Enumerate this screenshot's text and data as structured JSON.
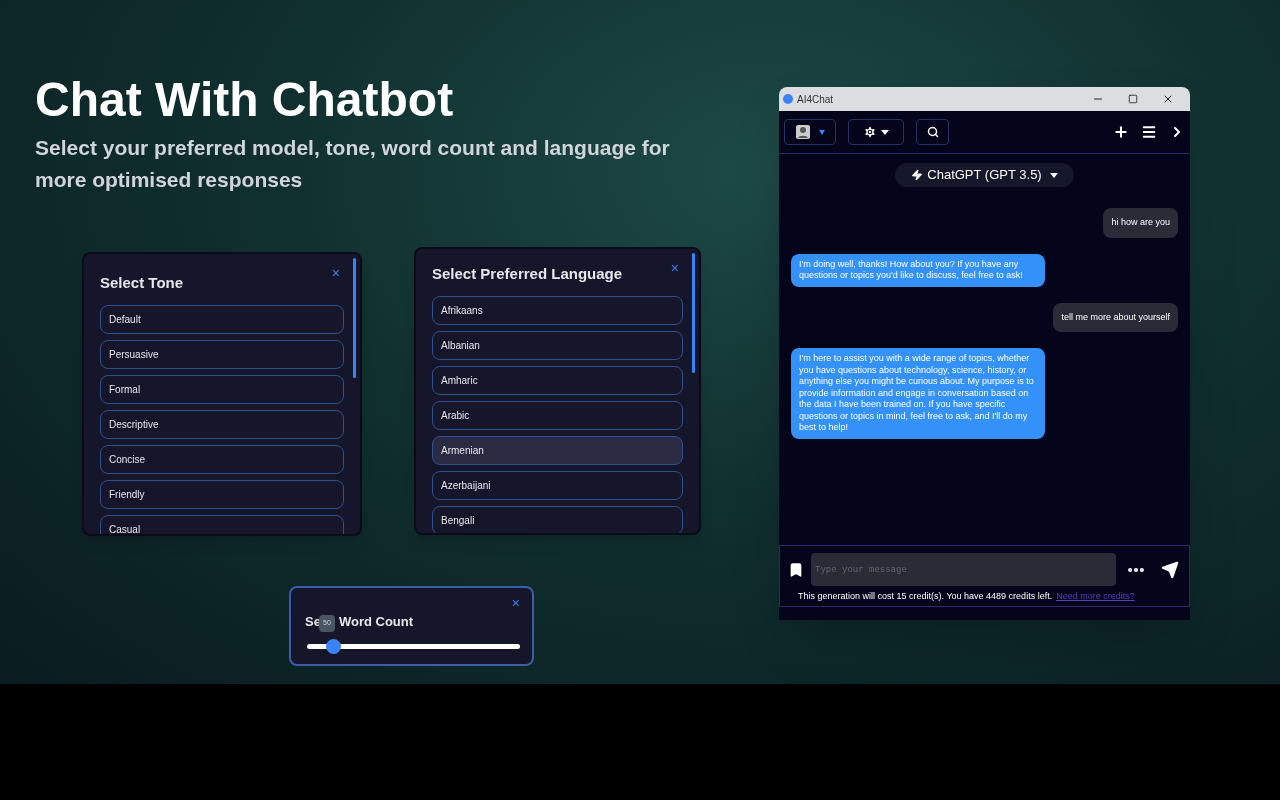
{
  "headline": {
    "title": "Chat With Chatbot",
    "subtitle": "Select your preferred model, tone, word count and language for more optimised responses"
  },
  "tone_panel": {
    "title": "Select Tone",
    "close": "×",
    "items": [
      {
        "label": "Default",
        "selected": false
      },
      {
        "label": "Persuasive",
        "selected": false
      },
      {
        "label": "Formal",
        "selected": false
      },
      {
        "label": "Descriptive",
        "selected": false
      },
      {
        "label": "Concise",
        "selected": false
      },
      {
        "label": "Friendly",
        "selected": false
      },
      {
        "label": "Casual",
        "selected": false
      }
    ]
  },
  "language_panel": {
    "title": "Select Preferred Language",
    "close": "×",
    "items": [
      {
        "label": "Afrikaans",
        "selected": false
      },
      {
        "label": "Albanian",
        "selected": false
      },
      {
        "label": "Amharic",
        "selected": false
      },
      {
        "label": "Arabic",
        "selected": false
      },
      {
        "label": "Armenian",
        "selected": true
      },
      {
        "label": "Azerbaijani",
        "selected": false
      },
      {
        "label": "Bengali",
        "selected": false
      }
    ]
  },
  "word_count_panel": {
    "title_start": "Se",
    "title_end": "Word Count",
    "close": "×",
    "tooltip": "50",
    "level": 0.12
  },
  "chat_window": {
    "title": "AI4Chat",
    "model": "ChatGPT (GPT 3.5)",
    "messages": [
      {
        "kind": "user",
        "text": "hi how are you"
      },
      {
        "kind": "bot",
        "text": "I'm doing well, thanks! How about you? If you have any questions or topics you'd like to discuss, feel free to ask!"
      },
      {
        "kind": "user",
        "text": "tell me more about yourself"
      },
      {
        "kind": "bot",
        "text": "I'm here to assist you with a wide range of topics, whether you have questions about technology, science, history, or anything else you might be curious about. My purpose is to provide information and engage in conversation based on the data I have been trained on. If you have specific questions or topics in mind, feel free to ask, and I'll do my best to help!"
      }
    ],
    "input": {
      "placeholder": "Type your message"
    },
    "credits_text": "This generation will cost 15 credit(s). You have 4489 credits left.",
    "credits_link": "Need more credits?"
  }
}
